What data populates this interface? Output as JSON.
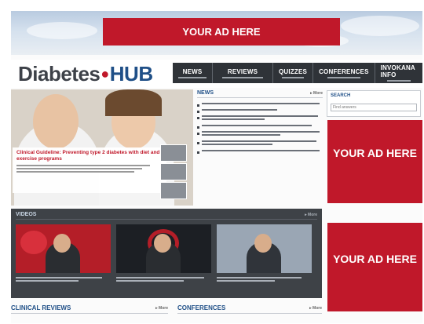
{
  "ads": {
    "top_label": "YOUR AD HERE",
    "right1_label": "YOUR AD HERE",
    "right2_label": "YOUR AD HERE",
    "color": "#c0182a"
  },
  "masthead": {
    "logo_part1": "Diabetes",
    "logo_part2": "HUB",
    "nav": [
      {
        "label": "NEWS"
      },
      {
        "label": "REVIEWS"
      },
      {
        "label": "QUIZZES"
      },
      {
        "label": "CONFERENCES"
      },
      {
        "label": "INVOKANA INFO"
      }
    ]
  },
  "hero": {
    "headline": "Clinical Guideline: Preventing type 2 diabetes with diet and exercise programs"
  },
  "news": {
    "title": "NEWS",
    "more": "▸ More"
  },
  "search": {
    "label": "SEARCH",
    "placeholder": "Find answers"
  },
  "videos": {
    "title": "VIDEOS",
    "more": "▸ More"
  },
  "bottom": {
    "clinical_title": "CLINICAL REVIEWS",
    "conferences_title": "CONFERENCES",
    "more": "▸ More"
  },
  "colors": {
    "brand_blue": "#1f4f87",
    "accent_red": "#c0182a",
    "nav_dark": "#2f3338",
    "video_band": "#3e4247"
  }
}
